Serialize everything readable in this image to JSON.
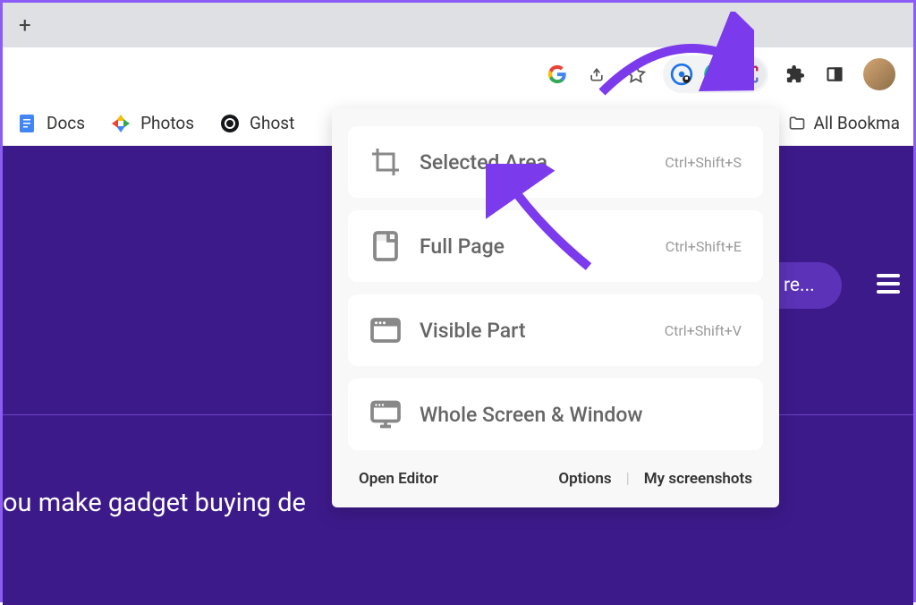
{
  "bookmarks": {
    "docs": "Docs",
    "photos": "Photos",
    "ghost": "Ghost",
    "all": "All Bookma"
  },
  "dropdown": {
    "items": [
      {
        "label": "Selected Area",
        "shortcut": "Ctrl+Shift+S"
      },
      {
        "label": "Full Page",
        "shortcut": "Ctrl+Shift+E"
      },
      {
        "label": "Visible Part",
        "shortcut": "Ctrl+Shift+V"
      },
      {
        "label": "Whole Screen & Window",
        "shortcut": ""
      }
    ],
    "footer": {
      "editor": "Open Editor",
      "options": "Options",
      "screenshots": "My screenshots"
    }
  },
  "page": {
    "headline": "ou make gadget buying de",
    "more": "re..."
  }
}
